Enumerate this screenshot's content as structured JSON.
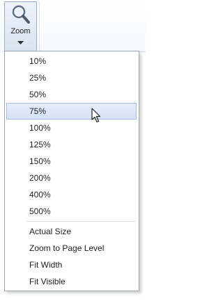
{
  "ribbon": {
    "zoom_button": {
      "label": "Zoom",
      "icon": "magnifier-icon",
      "dropdown_icon": "dropdown-arrow-icon"
    }
  },
  "zoom_menu": {
    "items": [
      {
        "label": "10%"
      },
      {
        "label": "25%"
      },
      {
        "label": "50%"
      },
      {
        "label": "75%",
        "selected": true
      },
      {
        "label": "100%"
      },
      {
        "label": "125%"
      },
      {
        "label": "150%"
      },
      {
        "label": "200%"
      },
      {
        "label": "400%"
      },
      {
        "label": "500%"
      }
    ],
    "fit_items": [
      {
        "label": "Actual Size"
      },
      {
        "label": "Zoom to Page Level"
      },
      {
        "label": "Fit Width"
      },
      {
        "label": "Fit Visible"
      }
    ],
    "hovered_item": "75%"
  },
  "colors": {
    "highlight": "#d3e0f6",
    "highlight_border": "#a7bde3",
    "menu_border": "#9aa6b4"
  }
}
